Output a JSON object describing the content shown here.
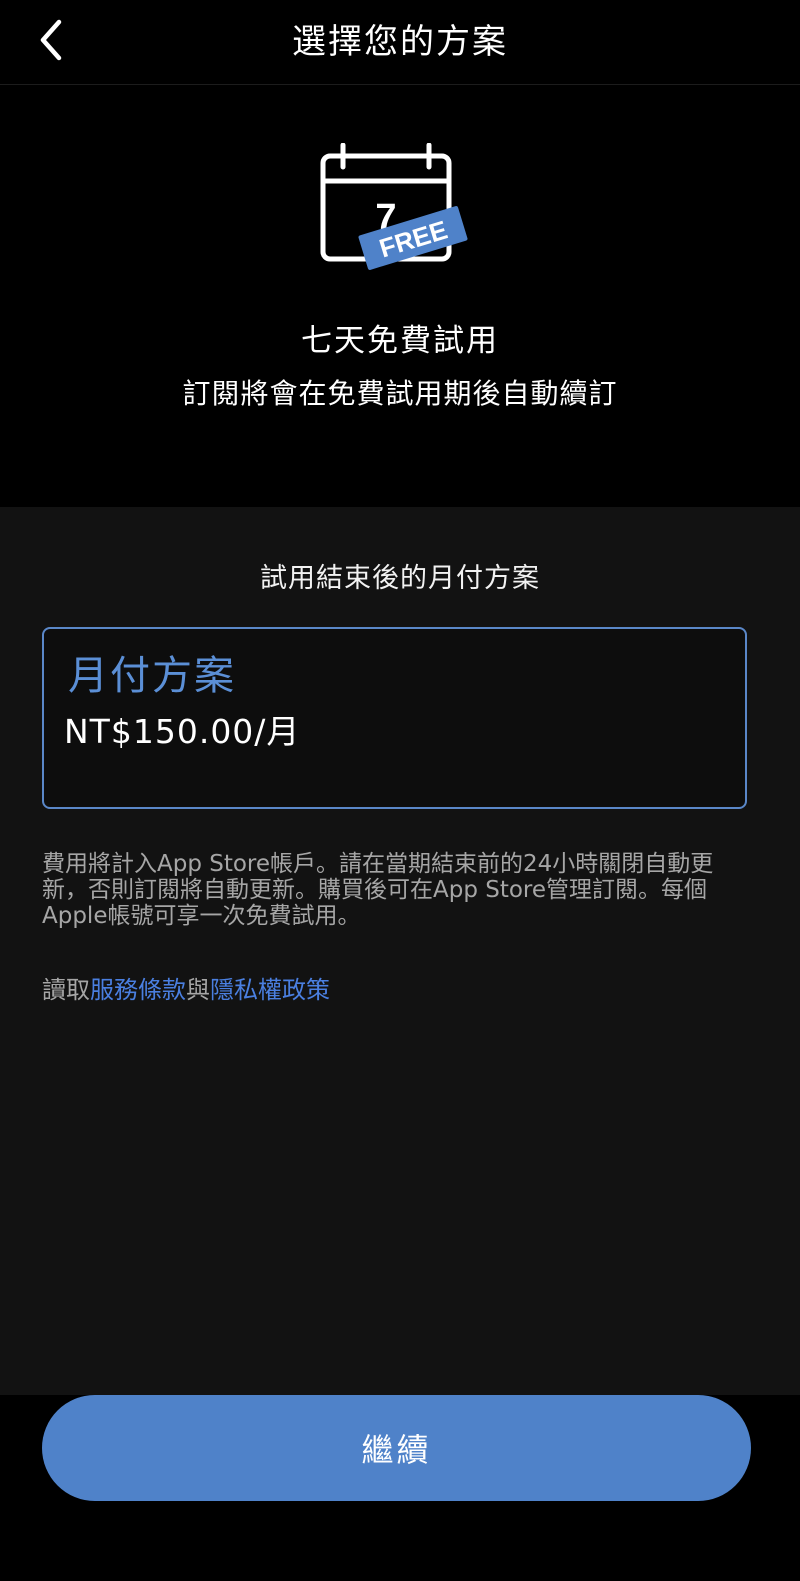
{
  "header": {
    "title": "選擇您的方案",
    "back_icon": "chevron-left-icon"
  },
  "hero": {
    "calendar_day": "7",
    "badge": "FREE",
    "title": "七天免費試用",
    "subtitle": "訂閱將會在免費試用期後自動續訂"
  },
  "plans": {
    "section_title": "試用結束後的月付方案",
    "selected": {
      "name": "月付方案",
      "price": "NT$150.00/月"
    }
  },
  "disclaimer": "費用將計入App Store帳戶。請在當期結束前的24小時關閉自動更新，否則訂閱將自動更新。購買後可在App Store管理訂閱。每個Apple帳號可享一次免費試用。",
  "terms": {
    "prefix": "讀取",
    "service_link": "服務條款",
    "conjunction": "與",
    "privacy_link": "隱私權政策"
  },
  "footer": {
    "continue_label": "繼續"
  },
  "colors": {
    "accent": "#4f82c9",
    "plan_name": "#5b8fd6",
    "link": "#4a7fe0",
    "panel_bg": "#121212"
  }
}
